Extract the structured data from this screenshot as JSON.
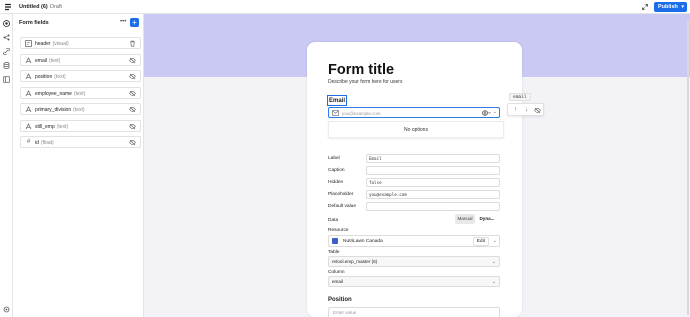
{
  "topbar": {
    "doc_title": "Untitled (6)",
    "status": "Draft",
    "publish_label": "Publish"
  },
  "panel": {
    "title": "Form fields",
    "fields": [
      {
        "name": "header",
        "type": "(visual)",
        "icon": "header-icon",
        "action": "trash-icon"
      },
      {
        "name": "email",
        "type": "(text)",
        "icon": "text-field-icon",
        "action": "eye-off-icon"
      },
      {
        "name": "position",
        "type": "(text)",
        "icon": "text-field-icon",
        "action": "eye-off-icon"
      },
      {
        "name": "employee_name",
        "type": "(text)",
        "icon": "text-field-icon",
        "action": "eye-off-icon"
      },
      {
        "name": "primary_division",
        "type": "(text)",
        "icon": "text-field-icon",
        "action": "eye-off-icon"
      },
      {
        "name": "still_emp",
        "type": "(text)",
        "icon": "text-field-icon",
        "action": "eye-off-icon"
      },
      {
        "name": "id",
        "type": "(float)",
        "icon": "number-field-icon",
        "action": "eye-off-icon"
      }
    ]
  },
  "form": {
    "title": "Form title",
    "description": "Describe your form here for users",
    "email": {
      "label": "Email",
      "placeholder": "you@example.com",
      "dropdown_message": "No options"
    },
    "inspector": {
      "label_label": "Label",
      "label_value": "Email",
      "caption_label": "Caption",
      "caption_value": "",
      "hidden_label": "Hidden",
      "hidden_value": "false",
      "placeholder_label": "Placeholder",
      "placeholder_value": "you@example.com",
      "default_label": "Default value",
      "default_value": "",
      "data_label": "Data",
      "data_modes": [
        "Manual",
        "Dyna..."
      ],
      "data_mode_selected": "Dyna...",
      "resource_label": "Resource",
      "resource_value": "NutriLawn Canada",
      "resource_edit": "Edit",
      "table_label": "Table",
      "table_value": "retool.emp_master (6)",
      "column_label": "Column",
      "column_value": "email"
    },
    "position": {
      "label": "Position",
      "placeholder": "Enter value"
    }
  },
  "field_tag": "email",
  "colors": {
    "accent": "#1c6ee8",
    "canvas_band": "#c9c9f3",
    "canvas_bg": "#f3f3f7"
  }
}
